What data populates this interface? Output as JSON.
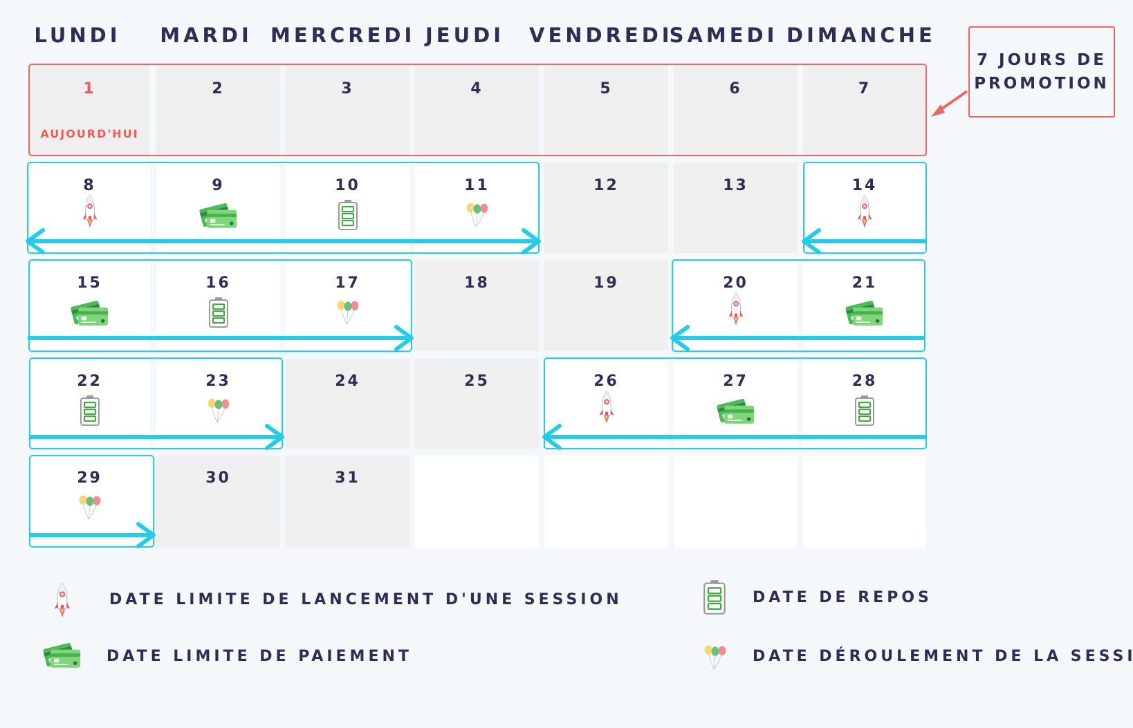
{
  "weekdays": [
    "LUNDI",
    "MARDI",
    "MERCREDI",
    "JEUDI",
    "VENDREDI",
    "SAMEDI",
    "DIMANCHE"
  ],
  "days": [
    "1",
    "2",
    "3",
    "4",
    "5",
    "6",
    "7",
    "8",
    "9",
    "10",
    "11",
    "12",
    "13",
    "14",
    "15",
    "16",
    "17",
    "18",
    "19",
    "20",
    "21",
    "22",
    "23",
    "24",
    "25",
    "26",
    "27",
    "28",
    "29",
    "30",
    "31"
  ],
  "today_label": "AUJOURD'HUI",
  "promo": {
    "line1": "7 JOURS DE",
    "line2": "PROMOTION"
  },
  "legend": {
    "launch": "DATE LIMITE DE LANCEMENT D'UNE SESSION",
    "payment": "DATE LIMITE DE PAIEMENT",
    "rest": "DATE DE REPOS",
    "session": "DATE DÉROULEMENT DE LA SESSION"
  },
  "colors": {
    "accent_cyan": "#23cde8",
    "accent_red": "#f06464",
    "text": "#2e2e52"
  },
  "day_icons": {
    "8": "rocket-icon",
    "9": "credit-card-icon",
    "10": "battery-icon",
    "11": "balloons-icon",
    "14": "rocket-icon",
    "15": "credit-card-icon",
    "16": "battery-icon",
    "17": "balloons-icon",
    "20": "rocket-icon",
    "21": "credit-card-icon",
    "22": "battery-icon",
    "23": "balloons-icon",
    "26": "rocket-icon",
    "27": "credit-card-icon",
    "28": "battery-icon",
    "29": "balloons-icon"
  }
}
